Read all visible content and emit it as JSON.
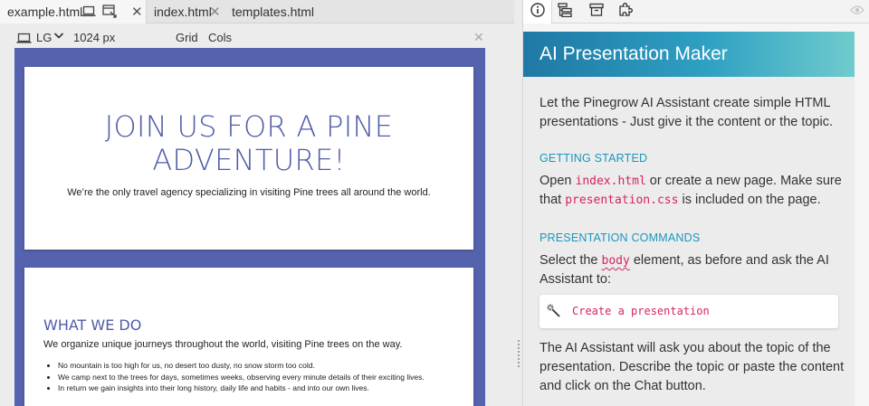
{
  "tabs": [
    {
      "label": "example.html",
      "active": true
    },
    {
      "label": "index.html",
      "active": false
    },
    {
      "label": "templates.html",
      "active": false
    }
  ],
  "viewbar": {
    "breakpoint": "LG",
    "width": "1024 px",
    "grid": "Grid",
    "cols": "Cols"
  },
  "page": {
    "hero_title_line1": "JOIN US FOR A PINE",
    "hero_title_line2": "ADVENTURE!",
    "hero_subtitle": "We’re the only travel agency specializing in visiting Pine trees all around the world.",
    "section_title": "WHAT WE DO",
    "section_lead": "We organize unique journeys throughout the world, visiting Pine trees on the way.",
    "bullets": [
      "No mountain is too high for us, no desert too dusty, no snow storm too cold.",
      "We camp next to the trees for days, sometimes weeks, observing every minute details of their exciting lives.",
      "In return we gain insights into their long history, daily life and habits - and into our own lives."
    ]
  },
  "panel": {
    "title": "AI Presentation Maker",
    "intro": "Let the Pinegrow AI Assistant create simple HTML presentations - Just give it the content or the topic.",
    "getting_started_heading": "GETTING STARTED",
    "gs_text1": "Open ",
    "gs_code1": "index.html",
    "gs_text2": " or create a new page. Make sure that ",
    "gs_code2": "presentation.css",
    "gs_text3": " is included on the page.",
    "commands_heading": "PRESENTATION COMMANDS",
    "cmd_text1": "Select the ",
    "cmd_code": "body",
    "cmd_text2": " element, as before and ask the AI Assistant to:",
    "command": "Create a presentation",
    "outro": "The AI Assistant will ask you about the topic of the presentation. Describe the topic or paste the content and click on the Chat button."
  },
  "colors": {
    "accent": "#1a96bf",
    "code": "#d6245e",
    "slide_heading": "#4f5ca8",
    "canvas_bg": "#5562ad"
  }
}
